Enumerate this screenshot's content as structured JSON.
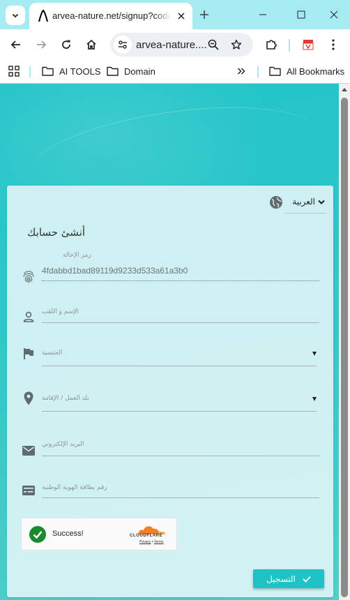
{
  "browser": {
    "tab_title": "arvea-nature.net/signup?code=",
    "url": "arvea-nature....",
    "bookmarks": {
      "ai_tools": "AI TOOLS",
      "domain": "Domain",
      "all_bookmarks": "All Bookmarks"
    },
    "theme_color": "#a6ebf1"
  },
  "form": {
    "language": "العربية",
    "title": "أنشئ حسابك",
    "referral": {
      "label": "رمز الإحالة",
      "value": "4fdabbd1bad89119d9233d533a61a3b0"
    },
    "full_name": {
      "placeholder": "الإسم و اللقب"
    },
    "nationality": {
      "placeholder": "الجنسية"
    },
    "country_of_residence": {
      "placeholder": "بلد العمل / الإقامة"
    },
    "email": {
      "placeholder": "البريد الإلكتروني"
    },
    "national_id": {
      "placeholder": "رقم بطاقة الهوية الوطنية"
    },
    "captcha": {
      "status": "Success!",
      "brand": "CLOUDFLARE",
      "privacy": "Privacy",
      "separator": "•",
      "terms": "Terms"
    },
    "submit_label": "التسجيل",
    "accent_color": "#1ec3c6"
  }
}
